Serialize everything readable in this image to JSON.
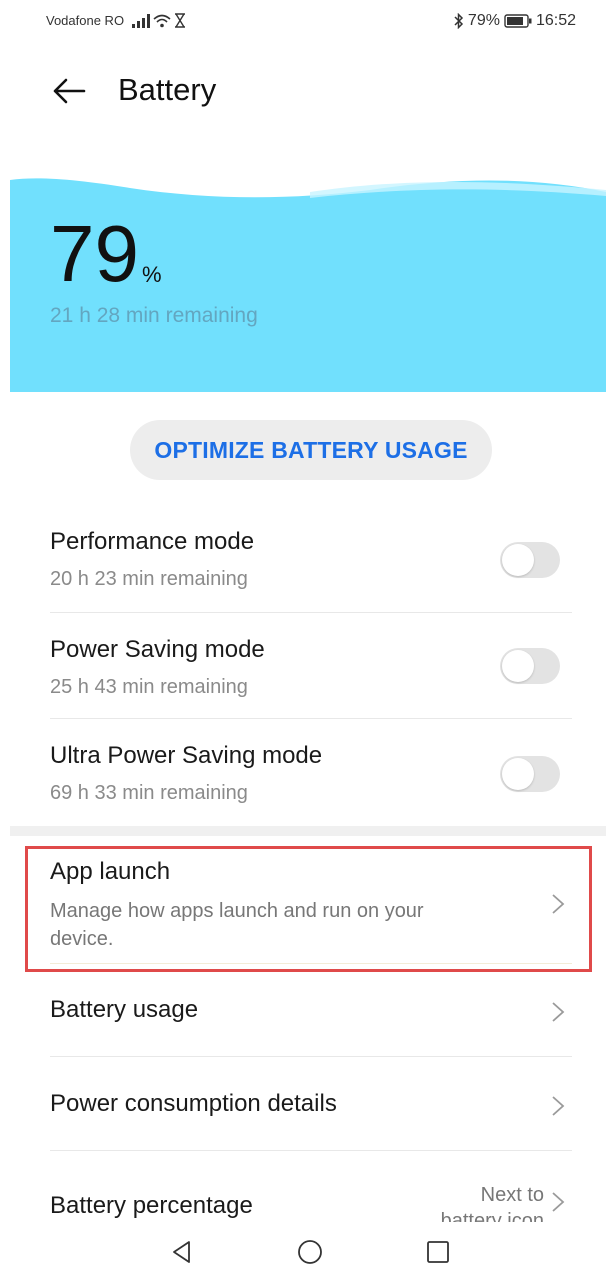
{
  "status_bar": {
    "carrier": "Vodafone RO",
    "battery_text": "79%",
    "time": "16:52"
  },
  "header": {
    "title": "Battery"
  },
  "battery": {
    "percent": "79",
    "percent_sign": "%",
    "remaining": "21 h 28 min remaining",
    "accent_color": "#71e0fd"
  },
  "optimize_label": "OPTIMIZE BATTERY USAGE",
  "modes": [
    {
      "title": "Performance mode",
      "subtitle": "20 h 23 min remaining",
      "enabled": false
    },
    {
      "title": "Power Saving mode",
      "subtitle": "25 h 43 min remaining",
      "enabled": false
    },
    {
      "title": "Ultra Power Saving mode",
      "subtitle": "69 h 33 min remaining",
      "enabled": false
    }
  ],
  "settings": [
    {
      "title": "App launch",
      "subtitle_line1": "Manage how apps launch and run on your",
      "subtitle_line2": "device."
    },
    {
      "title": "Battery usage"
    },
    {
      "title": "Power consumption details"
    },
    {
      "title": "Battery percentage",
      "value_line1": "Next to",
      "value_line2": "battery icon"
    }
  ],
  "highlight_color": "#e04a4a",
  "link_color": "#1d6fe6"
}
